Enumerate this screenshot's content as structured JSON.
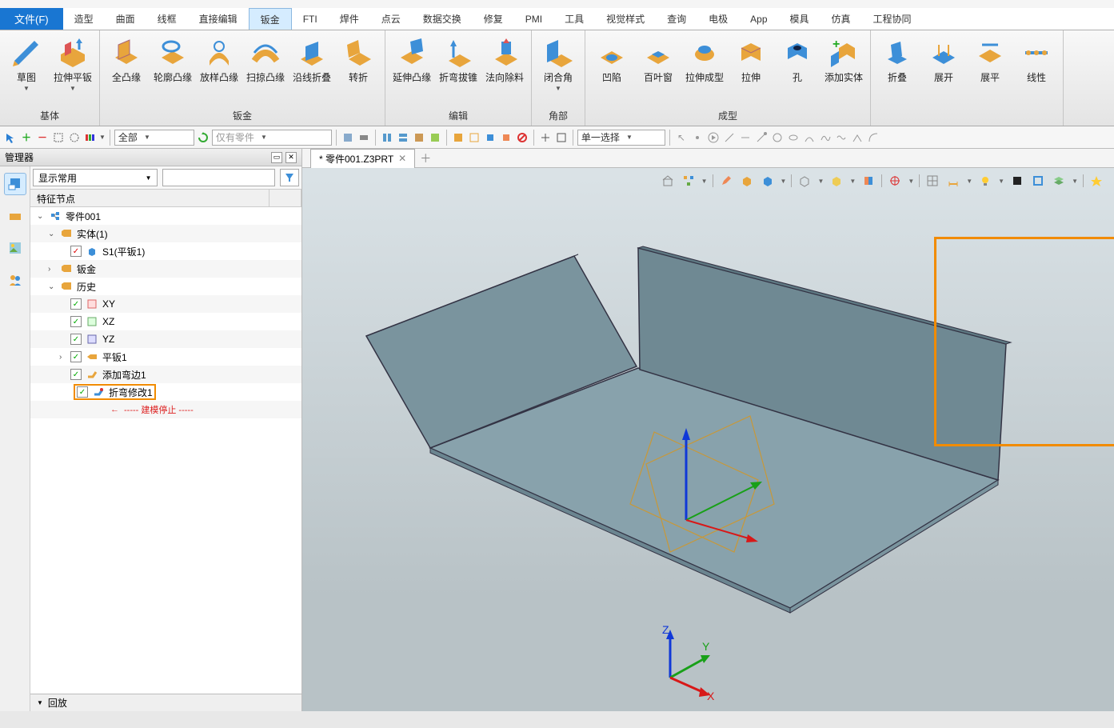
{
  "file_button": "文件(F)",
  "tabs": [
    "造型",
    "曲面",
    "线框",
    "直接编辑",
    "钣金",
    "FTI",
    "焊件",
    "点云",
    "数据交换",
    "修复",
    "PMI",
    "工具",
    "视觉样式",
    "查询",
    "电极",
    "App",
    "模具",
    "仿真",
    "工程协同"
  ],
  "active_tab_index": 4,
  "ribbon": {
    "groups": [
      {
        "label": "基体",
        "buttons": [
          {
            "name": "sketch",
            "label": "草图",
            "drop": true
          },
          {
            "name": "extrude-flange",
            "label": "拉伸平钣",
            "drop": true
          }
        ]
      },
      {
        "label": "钣金",
        "buttons": [
          {
            "name": "full-flange",
            "label": "全凸缘"
          },
          {
            "name": "contour-flange",
            "label": "轮廓凸缘"
          },
          {
            "name": "loft-flange",
            "label": "放样凸缘"
          },
          {
            "name": "sweep-flange",
            "label": "扫掠凸缘"
          },
          {
            "name": "edge-fold",
            "label": "沿线折叠"
          },
          {
            "name": "swivel",
            "label": "转折"
          }
        ]
      },
      {
        "label": "编辑",
        "buttons": [
          {
            "name": "extend-flange",
            "label": "延伸凸缘"
          },
          {
            "name": "bend-taper",
            "label": "折弯拔锥"
          },
          {
            "name": "normal-cut",
            "label": "法向除料"
          }
        ]
      },
      {
        "label": "角部",
        "buttons": [
          {
            "name": "close-corner",
            "label": "闭合角",
            "drop": true
          }
        ]
      },
      {
        "label": "成型",
        "buttons": [
          {
            "name": "dimple",
            "label": "凹陷"
          },
          {
            "name": "louver",
            "label": "百叶窗"
          },
          {
            "name": "stretch-form",
            "label": "拉伸成型"
          },
          {
            "name": "stretch",
            "label": "拉伸"
          },
          {
            "name": "hole",
            "label": "孔"
          },
          {
            "name": "add-solid",
            "label": "添加实体"
          }
        ]
      },
      {
        "label": "",
        "buttons": [
          {
            "name": "fold",
            "label": "折叠"
          },
          {
            "name": "unfold",
            "label": "展开"
          },
          {
            "name": "flatten",
            "label": "展平"
          },
          {
            "name": "linear",
            "label": "线性"
          }
        ]
      }
    ]
  },
  "sec_toolbar": {
    "combo1": "全部",
    "combo2": "仅有零件",
    "combo3": "单一选择"
  },
  "left_panel": {
    "title": "管理器",
    "display_combo": "显示常用",
    "column_header": "特征节点",
    "tree": {
      "root": "零件001",
      "solid_group": "实体(1)",
      "solid_item": "S1(平钣1)",
      "sheetmetal": "钣金",
      "history": "历史",
      "xy": "XY",
      "xz": "XZ",
      "yz": "YZ",
      "flat": "平钣1",
      "add_bend": "添加弯边1",
      "bend_modify": "折弯修改1",
      "stop": "----- 建模停止 -----"
    },
    "playback": "回放"
  },
  "doc_tab": "* 零件001.Z3PRT",
  "triad": {
    "x": "X",
    "y": "Y",
    "z": "Z"
  }
}
